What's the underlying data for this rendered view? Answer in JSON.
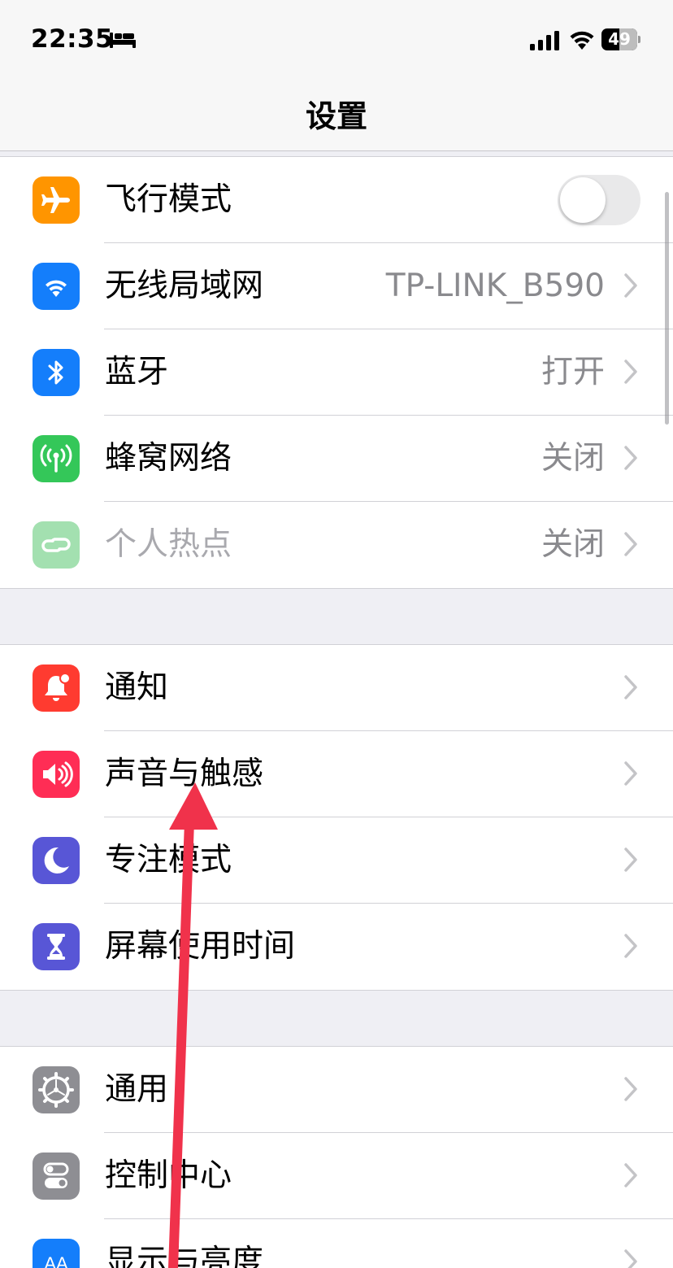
{
  "status_bar": {
    "time": "22:35",
    "icons": [
      "bed-icon",
      "cellular-signal-icon",
      "wifi-icon",
      "battery-icon"
    ],
    "battery_level": "49",
    "battery_fill_fraction": 0.49
  },
  "nav": {
    "title": "设置"
  },
  "groups": [
    {
      "rows": [
        {
          "name": "airplane-mode",
          "icon": "airplane-icon",
          "icon_color": "#ff9500",
          "label": "飞行模式",
          "toggle": true,
          "toggle_on": false
        },
        {
          "name": "wifi",
          "icon": "wifi-icon",
          "icon_color": "#147efb",
          "label": "无线局域网",
          "value": "TP-LINK_B590"
        },
        {
          "name": "bluetooth",
          "icon": "bluetooth-icon",
          "icon_color": "#147efb",
          "label": "蓝牙",
          "value": "打开"
        },
        {
          "name": "cellular",
          "icon": "antenna-icon",
          "icon_color": "#34c759",
          "label": "蜂窝网络",
          "value": "关闭"
        },
        {
          "name": "hotspot",
          "icon": "chain-link-icon",
          "icon_color": "#a3e0b0",
          "label": "个人热点",
          "value": "关闭",
          "disabled": true
        }
      ]
    },
    {
      "rows": [
        {
          "name": "notifications",
          "icon": "bell-icon",
          "icon_color": "#ff3b30",
          "label": "通知"
        },
        {
          "name": "sounds-haptics",
          "icon": "speaker-icon",
          "icon_color": "#ff2d55",
          "label": "声音与触感"
        },
        {
          "name": "focus",
          "icon": "moon-icon",
          "icon_color": "#5856d6",
          "label": "专注模式"
        },
        {
          "name": "screen-time",
          "icon": "hourglass-icon",
          "icon_color": "#5856d6",
          "label": "屏幕使用时间"
        }
      ]
    },
    {
      "rows": [
        {
          "name": "general",
          "icon": "gear-icon",
          "icon_color": "#8e8e93",
          "label": "通用"
        },
        {
          "name": "control-center",
          "icon": "switches-icon",
          "icon_color": "#8e8e93",
          "label": "控制中心"
        },
        {
          "name": "display-brightness",
          "icon": "text-size-icon",
          "icon_color": "#147efb",
          "label": "显示与亮度",
          "icon_text": "AA"
        }
      ]
    }
  ],
  "annotation": {
    "icon": "red-arrow-icon",
    "color": "#f0324b"
  }
}
